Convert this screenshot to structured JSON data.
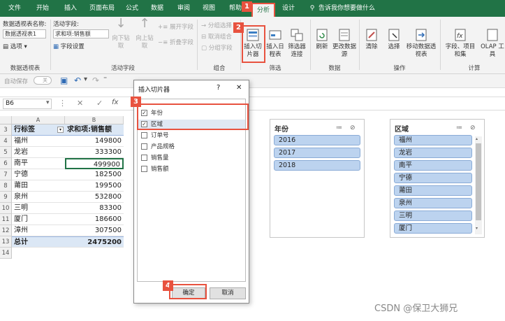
{
  "tabs": [
    "文件",
    "开始",
    "插入",
    "页面布局",
    "公式",
    "数据",
    "审阅",
    "视图",
    "帮助",
    "分析",
    "设计"
  ],
  "tell_me": "告诉我你想要做什么",
  "ribbon": {
    "pivot_name_label": "数据透视表名称:",
    "pivot_name_value": "数据透视表1",
    "options_label": "选项",
    "active_field_label": "活动字段:",
    "active_field_value": "求和项:销售额",
    "field_settings_label": "字段设置",
    "drill_down": "向下钻取",
    "drill_up": "向上钻取",
    "expand_field": "展开字段",
    "collapse_field": "折叠字段",
    "group_selection": "分组选择",
    "ungroup": "取消组合",
    "group_field": "分组字段",
    "insert_slicer": "插入切片器",
    "insert_timeline": "插入日程表",
    "filter_connections": "筛选器连接",
    "refresh": "刷新",
    "change_source": "更改数据源",
    "clear": "清除",
    "select": "选择",
    "move_pivot": "移动数据透视表",
    "fields_items": "字段、项目和集",
    "olap": "OLAP 工具",
    "groups": {
      "pivot": "数据透视表",
      "active_field": "活动字段",
      "group": "组合",
      "filter": "筛选",
      "data": "数据",
      "actions": "操作",
      "calc": "计算"
    }
  },
  "qab": {
    "autosave": "自动保存",
    "autosave_state": "关"
  },
  "formula_bar": {
    "namebox": "B6",
    "fx": "fx"
  },
  "sheet": {
    "columns": [
      "A",
      "B"
    ],
    "header_row": {
      "row": "3",
      "label": "行标签",
      "value_label": "求和项:销售额"
    },
    "rows": [
      {
        "row": "4",
        "city": "福州",
        "value": "149800"
      },
      {
        "row": "5",
        "city": "龙岩",
        "value": "333300"
      },
      {
        "row": "6",
        "city": "南平",
        "value": "499900"
      },
      {
        "row": "7",
        "city": "宁德",
        "value": "182500"
      },
      {
        "row": "8",
        "city": "莆田",
        "value": "199500"
      },
      {
        "row": "9",
        "city": "泉州",
        "value": "532800"
      },
      {
        "row": "10",
        "city": "三明",
        "value": "83300"
      },
      {
        "row": "11",
        "city": "厦门",
        "value": "186600"
      },
      {
        "row": "12",
        "city": "漳州",
        "value": "307500"
      }
    ],
    "total_row": {
      "row": "13",
      "label": "总计",
      "value": "2475200"
    },
    "extra_row": "14"
  },
  "dialog": {
    "title": "插入切片器",
    "help": "?",
    "close": "✕",
    "fields": [
      {
        "label": "年份",
        "checked": true
      },
      {
        "label": "区域",
        "checked": true
      },
      {
        "label": "订单号",
        "checked": false
      },
      {
        "label": "产品规格",
        "checked": false
      },
      {
        "label": "销售量",
        "checked": false
      },
      {
        "label": "销售额",
        "checked": false
      }
    ],
    "ok": "确定",
    "cancel": "取消"
  },
  "slicer_year": {
    "title": "年份",
    "items": [
      "2016",
      "2017",
      "2018"
    ]
  },
  "slicer_region": {
    "title": "区域",
    "items": [
      "福州",
      "龙岩",
      "南平",
      "宁德",
      "莆田",
      "泉州",
      "三明",
      "厦门"
    ]
  },
  "callouts": [
    "1",
    "2",
    "3",
    "4"
  ],
  "watermark": "CSDN @保卫大狮兄",
  "colors": {
    "excel_green": "#217346",
    "callout_red": "#e8523f",
    "slicer_item": "#bcd3ef"
  }
}
